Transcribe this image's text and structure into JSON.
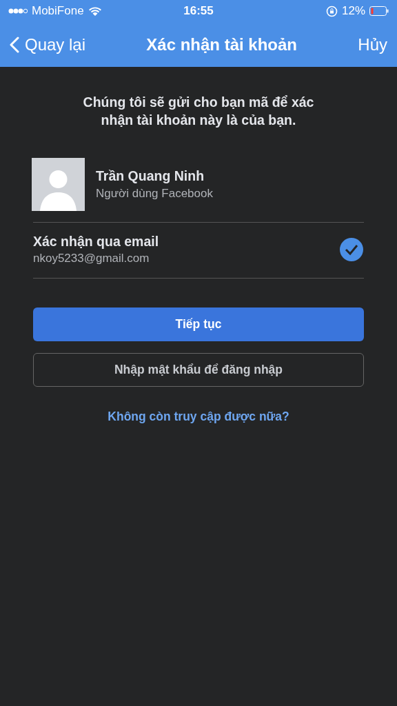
{
  "status_bar": {
    "carrier": "MobiFone",
    "time": "16:55",
    "battery": "12%"
  },
  "nav": {
    "back": "Quay lại",
    "title": "Xác nhận tài khoản",
    "cancel": "Hủy"
  },
  "intro": "Chúng tôi sẽ gửi cho bạn mã để xác nhận tài khoản này là của bạn.",
  "account": {
    "name": "Trần Quang Ninh",
    "subtitle": "Người dùng Facebook"
  },
  "options": [
    {
      "title": "Xác nhận qua email",
      "detail": "nkoy5233@gmail.com",
      "selected": true
    }
  ],
  "buttons": [
    {
      "kind": "primary",
      "label": "Tiếp tục"
    },
    {
      "kind": "secondary",
      "label": "Nhập mật khẩu để đăng nhập"
    }
  ],
  "link": "Không còn truy cập được nữa?"
}
